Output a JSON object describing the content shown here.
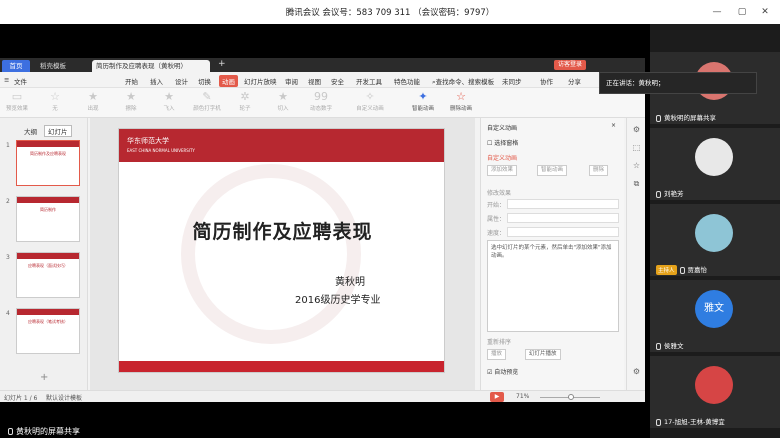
{
  "meeting": {
    "title": "腾讯会议 会议号：583 709 311 （会议密码：9797）",
    "window_min": "—",
    "window_max": "▢",
    "window_close": "✕"
  },
  "wps": {
    "tabs": {
      "home": "首页",
      "template": "稻壳模板",
      "file": "简历制作及应聘表现（黄秋明）",
      "login": "访客登录"
    },
    "menu": [
      "文件",
      "开始",
      "插入",
      "设计",
      "切换",
      "动画",
      "幻灯片放映",
      "审阅",
      "视图",
      "安全",
      "开发工具",
      "特色功能"
    ],
    "menu_right": [
      "查找命令、搜索模板",
      "未同步",
      "协作",
      "分享"
    ],
    "ribbon": [
      "预览效果",
      "无",
      "出现",
      "擦除",
      "飞入",
      "颜色打字机",
      "轮子",
      "切入",
      "动态数字",
      "自定义动画",
      "删除动画"
    ],
    "ribbon_smart": "智能动画",
    "outline_tabs": [
      "大纲",
      "幻灯片"
    ],
    "slide_count": "幻灯片 1 / 6",
    "theme_label": "默认设计模板",
    "zoom": "71%",
    "thumbs": [
      {
        "num": "1",
        "title": "简历制作及应聘表现"
      },
      {
        "num": "2",
        "title": "简历制作"
      },
      {
        "num": "3",
        "title": "应聘表现（面试技巧）"
      },
      {
        "num": "4",
        "title": "应聘表现（笔试考核）"
      }
    ]
  },
  "slide": {
    "university": "华东师范大学",
    "university_en": "EAST CHINA NORMAL UNIVERSITY",
    "title": "简历制作及应聘表现",
    "name": "黄秋明",
    "subtitle": "2016级历史学专业"
  },
  "anim_panel": {
    "header": "自定义动画",
    "select_pane": "选择窗格",
    "section": "自定义动画",
    "add_effect": "添加效果",
    "smart_anim": "智能动画",
    "delete": "删除",
    "modify": "修改效果",
    "start": "开始：",
    "property": "属性：",
    "speed": "速度：",
    "hint": "选中幻灯片的某个元素，然后单击\"添加效果\"添加动画。",
    "reorder": "重新排序",
    "play": "播放",
    "slideshow": "幻灯片播放",
    "autopreview": "自动预览"
  },
  "speaking": "正在讲话：黄秋明；",
  "participants": [
    {
      "name": "黄秋明的屏幕共享",
      "host": false
    },
    {
      "name": "刘艳芳",
      "host": false
    },
    {
      "name": "贾嘉怡",
      "host": true,
      "host_label": "主持人"
    },
    {
      "name": "侯雅文",
      "host": false,
      "initials": "雅文"
    },
    {
      "name": "17-旭旭-王林-黄博宜",
      "host": false
    }
  ],
  "bottom_label": "黄秋明的屏幕共享",
  "colors": {
    "accent": "#e35a4a",
    "slide_red": "#b72830",
    "wps_blue": "#3d6fe0"
  }
}
